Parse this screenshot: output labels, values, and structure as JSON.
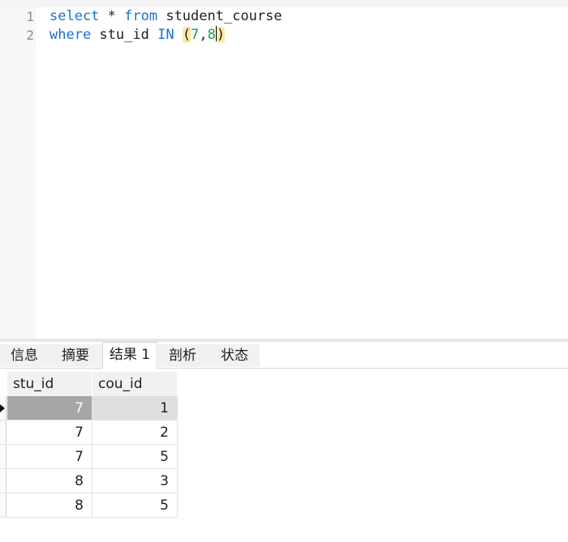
{
  "editor": {
    "line_numbers": [
      "1",
      "2"
    ],
    "line1": {
      "kw_select": "select",
      "star": " * ",
      "kw_from": "from",
      "table": " student_course"
    },
    "line2": {
      "kw_where": "where",
      "col": " stu_id ",
      "kw_in": "IN",
      "sp": " ",
      "open": "(",
      "n1": "7",
      "comma": ",",
      "n2": "8",
      "close": ")"
    }
  },
  "tabs": [
    {
      "label": "信息"
    },
    {
      "label": "摘要"
    },
    {
      "label": "结果 1",
      "active": true
    },
    {
      "label": "剖析"
    },
    {
      "label": "状态"
    }
  ],
  "grid": {
    "columns": [
      "stu_id",
      "cou_id"
    ],
    "rows": [
      [
        "7",
        "1"
      ],
      [
        "7",
        "2"
      ],
      [
        "7",
        "5"
      ],
      [
        "8",
        "3"
      ],
      [
        "8",
        "5"
      ]
    ],
    "selected_row": 0
  }
}
